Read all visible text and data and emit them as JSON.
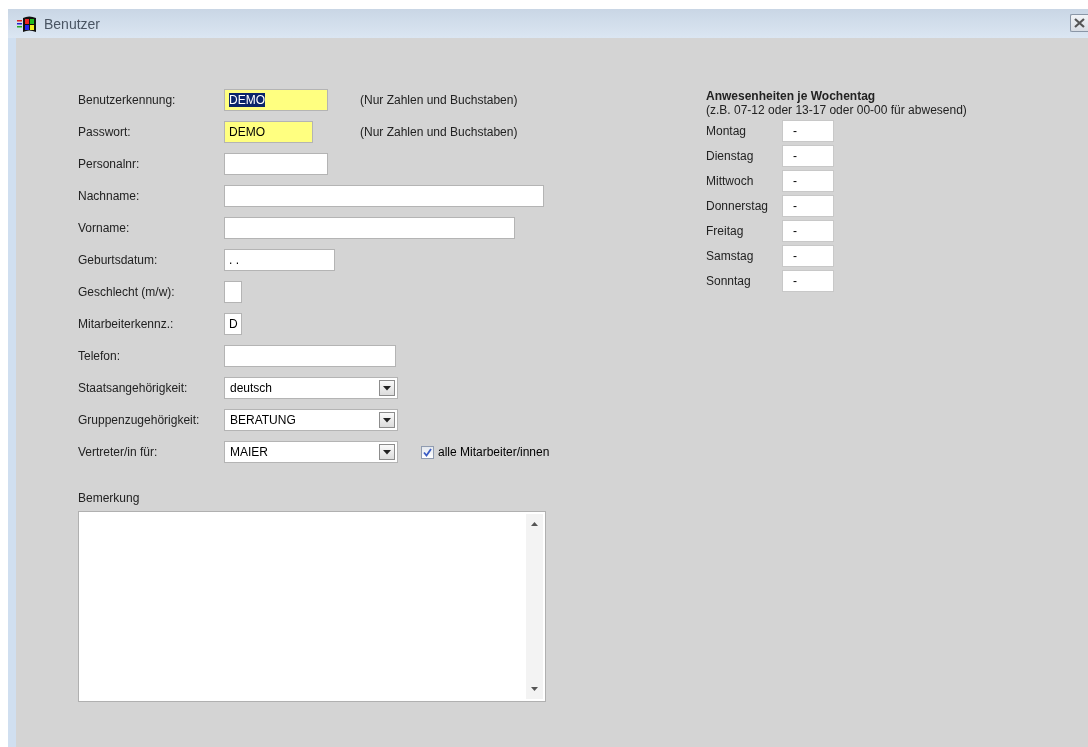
{
  "window": {
    "title": "Benutzer"
  },
  "fields": [
    {
      "kind": "text",
      "label": "Benutzerkennung:",
      "value": "DEMO",
      "required": true,
      "text_selected": true,
      "hint": "(Nur Zahlen und Buchstaben)"
    },
    {
      "kind": "text",
      "label": "Passwort:",
      "value": "DEMO",
      "required": true,
      "text_selected": false,
      "hint": "(Nur Zahlen und Buchstaben)"
    },
    {
      "kind": "text",
      "label": "Personalnr:",
      "required": false
    },
    {
      "kind": "text",
      "label": "Nachname:",
      "required": false
    },
    {
      "kind": "text",
      "label": "Vorname:",
      "required": false
    },
    {
      "kind": "text",
      "label": "Geburtsdatum:",
      "value": ". .",
      "required": false,
      "text_selected": false
    },
    {
      "kind": "text",
      "label": "Geschlecht (m/w):",
      "required": false
    },
    {
      "kind": "text",
      "label": "Mitarbeiterkennz.:",
      "value": "D",
      "required": false,
      "text_selected": false
    },
    {
      "kind": "text",
      "label": "Telefon:",
      "required": false
    },
    {
      "kind": "select",
      "label": "Staatsangehörigkeit:",
      "value": "deutsch"
    },
    {
      "kind": "select",
      "label": "Gruppenzugehörigkeit:",
      "value": "BERATUNG"
    },
    {
      "kind": "select",
      "label": "Vertreter/in für:",
      "value": "MAIER",
      "checkbox": {
        "label": "alle Mitarbeiter/innen",
        "checked": true
      }
    }
  ],
  "remark": {
    "label": "Bemerkung"
  },
  "attendance": {
    "title": "Anwesenheiten je Wochentag",
    "hint": "(z.B. 07-12 oder 13-17 oder 00-00 für abwesend)",
    "days": [
      {
        "label": "Montag",
        "value": "-"
      },
      {
        "label": "Dienstag",
        "value": "-"
      },
      {
        "label": "Mittwoch",
        "value": "-"
      },
      {
        "label": "Donnerstag",
        "value": "-"
      },
      {
        "label": "Freitag",
        "value": "-"
      },
      {
        "label": "Samstag",
        "value": "-"
      },
      {
        "label": "Sonntag",
        "value": "-"
      }
    ]
  }
}
